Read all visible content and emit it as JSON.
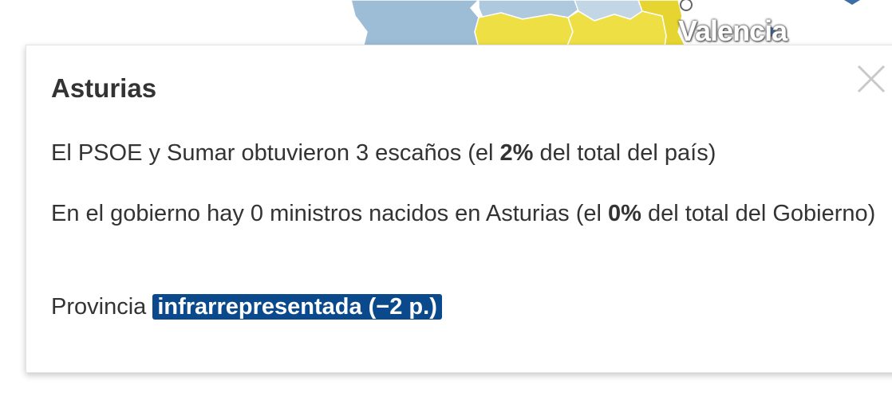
{
  "map": {
    "city_label": "Valencia",
    "colors": {
      "blue_region": "#9dbcd6",
      "light_blue_region": "#c3d6e6",
      "yellow_region": "#eedf45",
      "border": "#ffffff",
      "marker": "#3a6ea5"
    }
  },
  "popup": {
    "title": "Asturias",
    "seats": {
      "prefix": "El PSOE y Sumar obtuvieron 3 escaños (el ",
      "percent": "2%",
      "suffix": " del total del país)"
    },
    "ministers": {
      "prefix": "En el gobierno hay 0 ministros nacidos en Asturias (el ",
      "percent": "0%",
      "suffix": " del total del Gobierno)"
    },
    "representation": {
      "prefix": "Provincia ",
      "badge": "infrarrepresentada (−2 p.)",
      "badge_color": "#0a4a8c"
    },
    "close_icon": "close-icon"
  }
}
